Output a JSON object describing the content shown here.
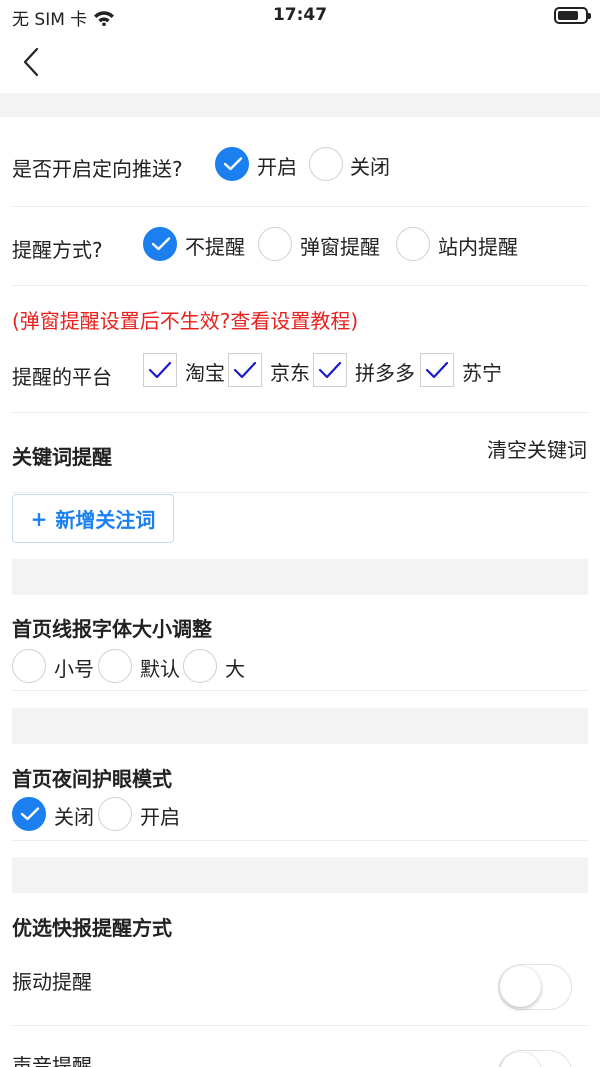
{
  "status_bar": {
    "carrier": "无 SIM 卡",
    "time": "17:47"
  },
  "push": {
    "label": "是否开启定向推送?",
    "options": [
      "开启",
      "关闭"
    ],
    "selected": 0
  },
  "remind_mode": {
    "label": "提醒方式?",
    "options": [
      "不提醒",
      "弹窗提醒",
      "站内提醒"
    ],
    "selected": 0
  },
  "warning_text": "(弹窗提醒设置后不生效?查看设置教程)",
  "platforms": {
    "label": "提醒的平台",
    "options": [
      "淘宝",
      "京东",
      "拼多多",
      "苏宁"
    ],
    "checked": [
      true,
      true,
      true,
      true
    ]
  },
  "keywords": {
    "title": "关键词提醒",
    "clear_label": "清空关键词",
    "add_label": "新增关注词",
    "add_icon": "+"
  },
  "font_size": {
    "title": "首页线报字体大小调整",
    "options": [
      "小号",
      "默认",
      "大"
    ],
    "selected": -1
  },
  "night_mode": {
    "title": "首页夜间护眼模式",
    "options": [
      "关闭",
      "开启"
    ],
    "selected": 0
  },
  "quick_remind": {
    "title": "优选快报提醒方式",
    "items": [
      {
        "label": "振动提醒",
        "on": false
      },
      {
        "label": "声音提醒",
        "on": false
      }
    ]
  },
  "colors": {
    "accent": "#1b7ff0",
    "warning": "#e8231f",
    "check": "#1a1ad0"
  }
}
